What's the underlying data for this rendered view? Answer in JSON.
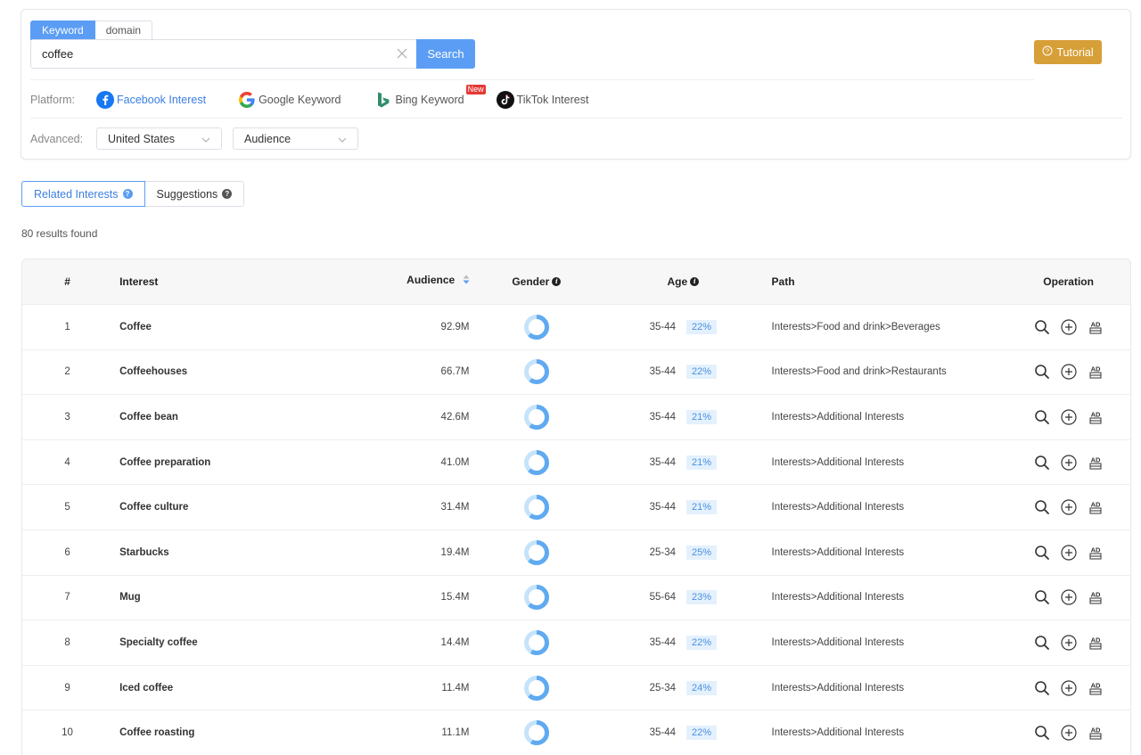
{
  "search": {
    "tabs": [
      "Keyword",
      "domain"
    ],
    "value": "coffee",
    "button": "Search",
    "tutorial": "Tutorial"
  },
  "platform": {
    "label": "Platform:",
    "options": [
      {
        "label": "Facebook Interest",
        "icon": "facebook-icon",
        "active": true
      },
      {
        "label": "Google Keyword",
        "icon": "google-icon"
      },
      {
        "label": "Bing Keyword",
        "icon": "bing-icon",
        "badge": "New"
      },
      {
        "label": "TikTok Interest",
        "icon": "tiktok-icon"
      }
    ]
  },
  "advanced": {
    "label": "Advanced:",
    "country": "United States",
    "sort": "Audience"
  },
  "result_tabs": [
    "Related Interests",
    "Suggestions"
  ],
  "results_count": "80 results found",
  "table": {
    "headers": {
      "num": "#",
      "interest": "Interest",
      "audience": "Audience",
      "gender": "Gender",
      "age": "Age",
      "path": "Path",
      "operation": "Operation"
    },
    "rows": [
      {
        "num": "1",
        "interest": "Coffee",
        "audience": "92.9M",
        "female_share": 0.62,
        "age": "35-44",
        "age_pct": "22%",
        "path": "Interests>Food and drink>Beverages"
      },
      {
        "num": "2",
        "interest": "Coffeehouses",
        "audience": "66.7M",
        "female_share": 0.6,
        "age": "35-44",
        "age_pct": "22%",
        "path": "Interests>Food and drink>Restaurants"
      },
      {
        "num": "3",
        "interest": "Coffee bean",
        "audience": "42.6M",
        "female_share": 0.6,
        "age": "35-44",
        "age_pct": "21%",
        "path": "Interests>Additional Interests"
      },
      {
        "num": "4",
        "interest": "Coffee preparation",
        "audience": "41.0M",
        "female_share": 0.62,
        "age": "35-44",
        "age_pct": "21%",
        "path": "Interests>Additional Interests"
      },
      {
        "num": "5",
        "interest": "Coffee culture",
        "audience": "31.4M",
        "female_share": 0.6,
        "age": "35-44",
        "age_pct": "21%",
        "path": "Interests>Additional Interests"
      },
      {
        "num": "6",
        "interest": "Starbucks",
        "audience": "19.4M",
        "female_share": 0.62,
        "age": "25-34",
        "age_pct": "25%",
        "path": "Interests>Additional Interests"
      },
      {
        "num": "7",
        "interest": "Mug",
        "audience": "15.4M",
        "female_share": 0.62,
        "age": "55-64",
        "age_pct": "23%",
        "path": "Interests>Additional Interests"
      },
      {
        "num": "8",
        "interest": "Specialty coffee",
        "audience": "14.4M",
        "female_share": 0.58,
        "age": "35-44",
        "age_pct": "22%",
        "path": "Interests>Additional Interests"
      },
      {
        "num": "9",
        "interest": "Iced coffee",
        "audience": "11.4M",
        "female_share": 0.62,
        "age": "25-34",
        "age_pct": "24%",
        "path": "Interests>Additional Interests"
      },
      {
        "num": "10",
        "interest": "Coffee roasting",
        "audience": "11.1M",
        "female_share": 0.58,
        "age": "35-44",
        "age_pct": "22%",
        "path": "Interests>Additional Interests"
      }
    ]
  },
  "colors": {
    "accent": "#5b9df5",
    "tutorial": "#d69f37",
    "gender_female": "#c5e3fa",
    "gender_male": "#5faaf0"
  }
}
